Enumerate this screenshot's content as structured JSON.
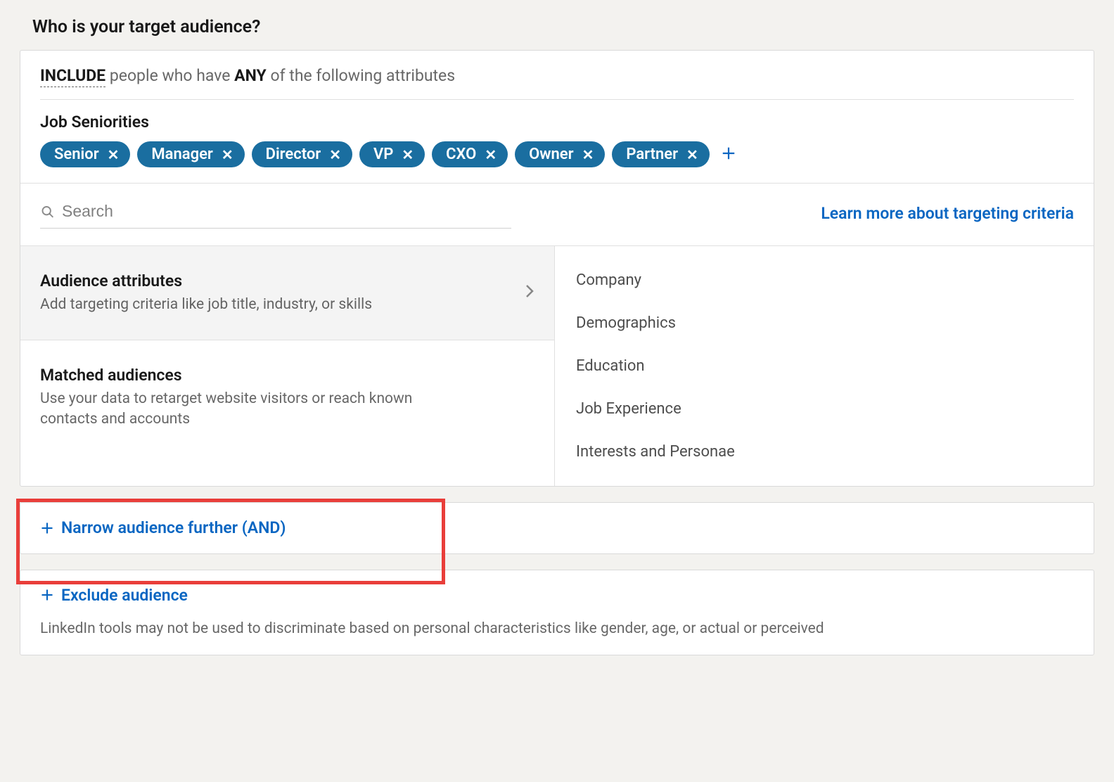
{
  "page": {
    "title": "Who is your target audience?"
  },
  "include": {
    "prefix_word": "INCLUDE",
    "middle_text": " people who have ",
    "any_word": "ANY",
    "suffix_text": " of the following attributes"
  },
  "category": {
    "label": "Job Seniorities",
    "chips": [
      "Senior",
      "Manager",
      "Director",
      "VP",
      "CXO",
      "Owner",
      "Partner"
    ]
  },
  "search": {
    "placeholder": "Search",
    "learn_more": "Learn more about targeting criteria"
  },
  "left": {
    "items": [
      {
        "title": "Audience attributes",
        "desc": "Add targeting criteria like job title, industry, or skills",
        "active": true
      },
      {
        "title": "Matched audiences",
        "desc": "Use your data to retarget website visitors or reach known contacts and accounts",
        "active": false
      }
    ]
  },
  "right": {
    "items": [
      "Company",
      "Demographics",
      "Education",
      "Job Experience",
      "Interests and Personae"
    ]
  },
  "narrow": {
    "label": "Narrow audience further (AND)"
  },
  "exclude": {
    "label": "Exclude audience"
  },
  "disclaimer": "LinkedIn tools may not be used to discriminate based on personal characteristics like gender, age, or actual or perceived"
}
